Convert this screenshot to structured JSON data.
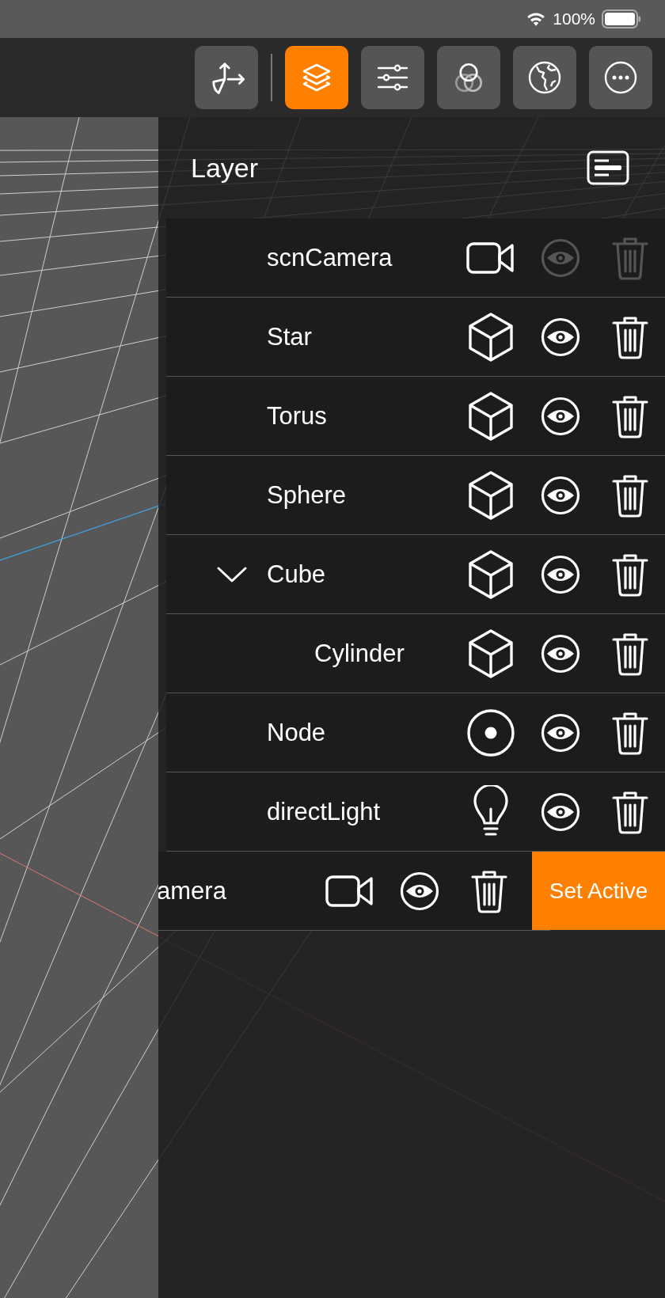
{
  "status_bar": {
    "battery": "100%"
  },
  "toolbar": [
    {
      "kind": "transform",
      "selected": false
    },
    {
      "kind": "layers",
      "selected": true
    },
    {
      "kind": "sliders",
      "selected": false
    },
    {
      "kind": "materials",
      "selected": false
    },
    {
      "kind": "world",
      "selected": false
    },
    {
      "kind": "more",
      "selected": false
    }
  ],
  "panel": {
    "title": "Layer",
    "rows": [
      {
        "name": "scnCamera",
        "kind": "camera",
        "disabled": true
      },
      {
        "name": "Star",
        "kind": "object",
        "disabled": false
      },
      {
        "name": "Torus",
        "kind": "object",
        "disabled": false
      },
      {
        "name": "Sphere",
        "kind": "object",
        "disabled": false
      },
      {
        "name": "Cube",
        "kind": "object",
        "disabled": false,
        "expanded": true,
        "children": [
          {
            "name": "Cylinder",
            "kind": "object",
            "disabled": false
          }
        ]
      },
      {
        "name": "Node",
        "kind": "node",
        "disabled": false
      },
      {
        "name": "directLight",
        "kind": "light",
        "disabled": false
      },
      {
        "name": "amera",
        "kind": "camera",
        "disabled": false,
        "swiped": true,
        "action": "Set Active"
      }
    ]
  }
}
